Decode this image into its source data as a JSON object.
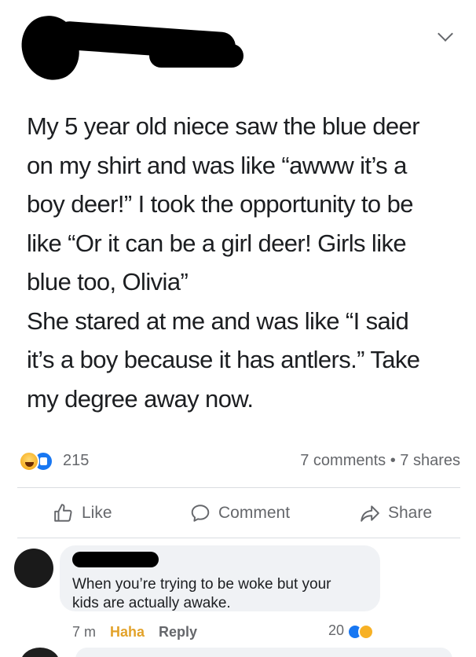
{
  "post": {
    "body": [
      "My 5 year old niece saw the blue deer\non my shirt and was like “awww it’s a\nboy deer!” I took the opportunity to be\nlike “Or it can be a girl deer! Girls like\nblue too, Olivia”",
      "She stared at me and was like “I said\nit’s a boy because it has antlers.” Take\nmy degree away now."
    ],
    "reaction_count": "215",
    "meta_counts": "7 comments • 7 shares"
  },
  "actions": {
    "like": "Like",
    "comment": "Comment",
    "share": "Share"
  },
  "comment": {
    "text": "When you’re trying to be woke but your\nkids are actually awake.",
    "time": "7 m",
    "haha": "Haha",
    "reply": "Reply",
    "reaction_count": "20"
  },
  "colors": {
    "like_blue": "#1877f2",
    "haha_yellow": "#f7b125",
    "meta_gray": "#65676b",
    "bubble_bg": "#f0f2f5"
  }
}
